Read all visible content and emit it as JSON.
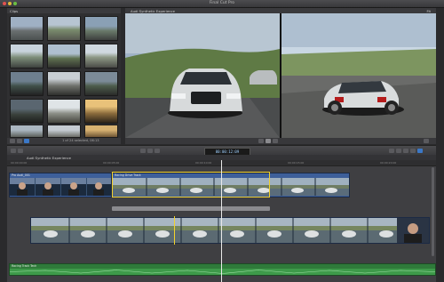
{
  "app": {
    "title": "Final Cut Pro"
  },
  "browser": {
    "header_label": "Clips",
    "clip_count": "1 of 24 selected, 06:13"
  },
  "viewer": {
    "clip_name": "Audi Synthetic Experience",
    "zoom": "Fit"
  },
  "toolbar": {
    "timecode": "00:00:12:09"
  },
  "timeline": {
    "project_name": "Audi Synthetic Experience",
    "ruler_ticks": [
      "00:00:00:00",
      "00:00:05:00",
      "00:00:10:00",
      "00:00:15:00",
      "00:00:20:00",
      "00:00:25:00"
    ],
    "primary_clip_a": "Pro Audi_001",
    "primary_clip_b": "Racing Drive Track",
    "audio_clip": "Racing Track Tech"
  },
  "colors": {
    "accent": "#f3d22d",
    "timeline_clip": "#3d5f9a",
    "audio_clip": "#2f7a3a"
  }
}
